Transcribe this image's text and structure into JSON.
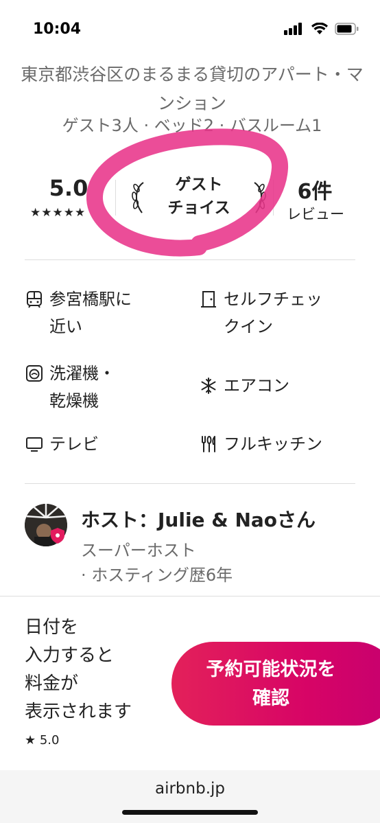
{
  "status_bar": {
    "time": "10:04"
  },
  "listing": {
    "title": "東京都渋谷区のまるまる貸切のアパート・マンション",
    "details": "ゲスト3人 · ベッド2 · バスルーム1"
  },
  "stats": {
    "rating": "5.0",
    "stars": "★★★★★",
    "guest_choice_label": "ゲスト\nチョイス",
    "reviews_count": "6件",
    "reviews_label": "レビュー"
  },
  "amenities": [
    {
      "label": "参宮橋駅に\n近い",
      "icon": "train-icon"
    },
    {
      "label": "セルフチェッ\nクイン",
      "icon": "door-icon"
    },
    {
      "label": "洗濯機・\n乾燥機",
      "icon": "washer-icon"
    },
    {
      "label": "エアコン",
      "icon": "snowflake-icon"
    },
    {
      "label": "テレビ",
      "icon": "tv-icon"
    },
    {
      "label": "フルキッチン",
      "icon": "kitchen-icon"
    }
  ],
  "host": {
    "title": "ホスト：Julie & Naoさん",
    "meta": "スーパーホスト\n· ホスティング歴6年"
  },
  "footer": {
    "price_note": "日付を\n入力すると\n料金が\n表示されます",
    "rating": "★ 5.0",
    "cta_label": "予約可能状況を\n確認"
  },
  "browser": {
    "url": "airbnb.jp"
  },
  "colors": {
    "accent": "#e31c5f",
    "highlight": "#e8348a",
    "text": "#222222",
    "muted": "#6a6a6a"
  }
}
